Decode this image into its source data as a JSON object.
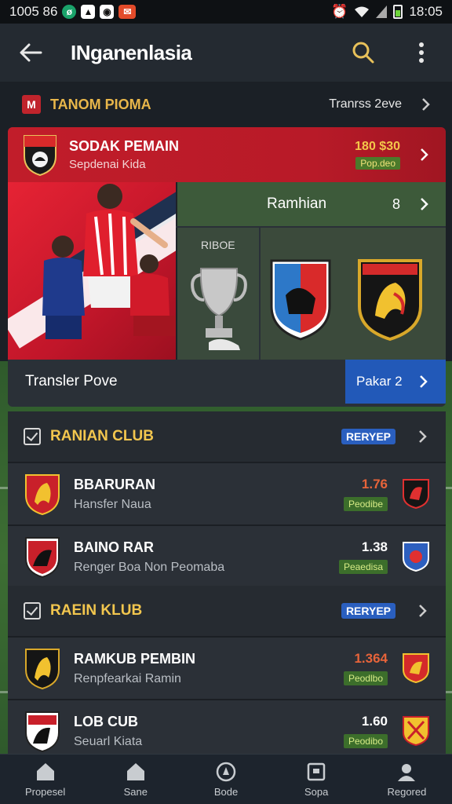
{
  "status_bar": {
    "time_left": "1005 86",
    "time_right": "18:05"
  },
  "header": {
    "title": "INganenlasia"
  },
  "tournament": {
    "badge": "M",
    "name": "TANOM PIOMA",
    "link": "Tranrss 2eve"
  },
  "featured": {
    "title": "SODAK PEMAIN",
    "subtitle": "Sepdenai Kida",
    "score": "180 $30",
    "pill": "Pop.deo",
    "ramhian_label": "Ramhian",
    "ramhian_num": "8",
    "trophy_label": "RIBOE",
    "transfer_label": "Transler Pove",
    "transfer_button": "Pakar 2"
  },
  "sections": [
    {
      "title": "RANIAN CLUB",
      "badge": "RERYEP",
      "rows": [
        {
          "name": "BBARURAN",
          "sub": "Hansfer Naua",
          "value": "1.76",
          "pill": "Peodibe"
        },
        {
          "name": "BAINO RAR",
          "sub": "Renger Boa Non Peomaba",
          "value": "1.38",
          "pill": "Peaedisa"
        }
      ]
    },
    {
      "title": "RAEIN KLUB",
      "badge": "RERYEP",
      "rows": [
        {
          "name": "RAMKUB PEMBIN",
          "sub": "Renpfearkai Ramin",
          "value": "1.364",
          "pill": "Peodlbo"
        },
        {
          "name": "LOB CUB",
          "sub": "Seuarl Kiata",
          "value": "1.60",
          "pill": "Peodibo"
        }
      ]
    }
  ],
  "bottom_nav": [
    {
      "label": "Propesel",
      "icon": "home-icon"
    },
    {
      "label": "Sane",
      "icon": "home-icon"
    },
    {
      "label": "Bode",
      "icon": "compass-icon"
    },
    {
      "label": "Sopa",
      "icon": "box-icon"
    },
    {
      "label": "Regored",
      "icon": "profile-icon"
    }
  ],
  "colors": {
    "accent_red": "#c11d2a",
    "accent_gold": "#f2c64e",
    "accent_blue": "#2259b8",
    "pill_green": "#3c6e2b"
  }
}
